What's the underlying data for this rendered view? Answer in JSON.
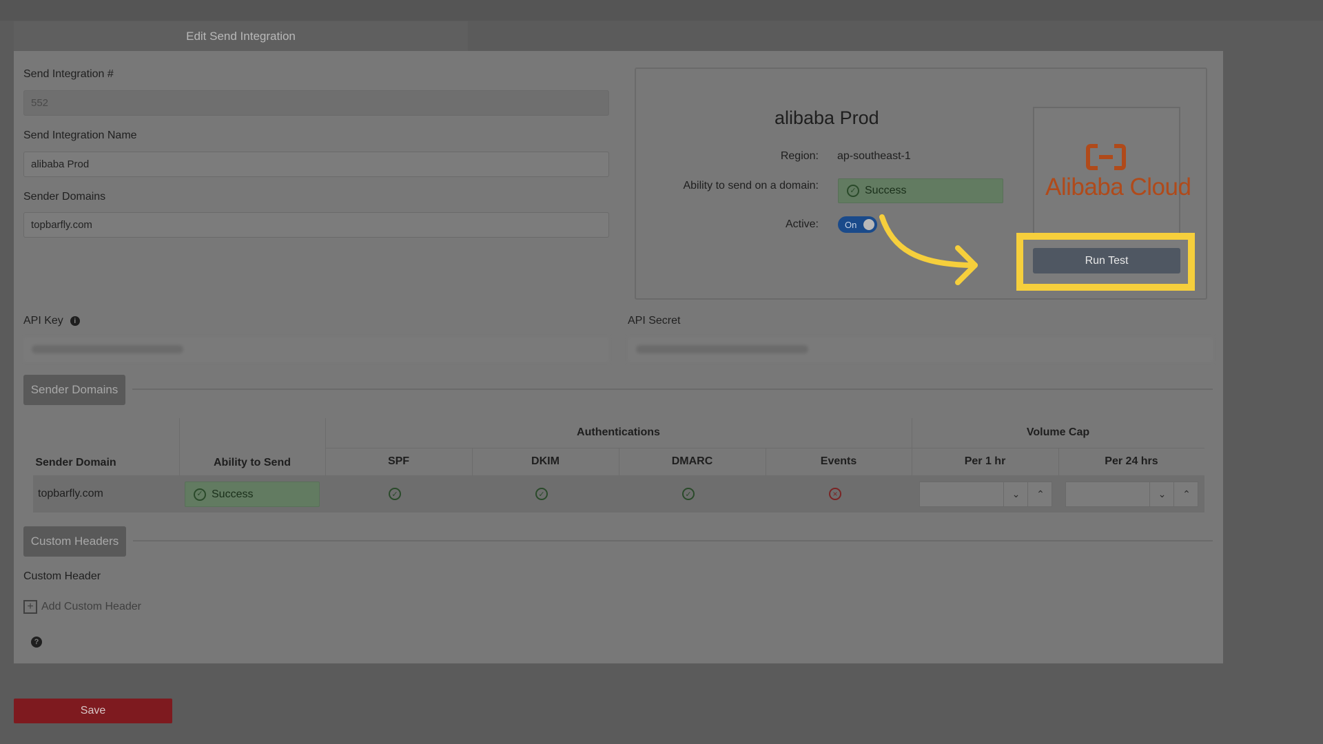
{
  "header": {
    "title": "Edit Send Integration"
  },
  "form": {
    "integration_number_label": "Send Integration #",
    "integration_number_value": "552",
    "integration_name_label": "Send Integration Name",
    "integration_name_value": "alibaba Prod",
    "sender_domains_label": "Sender Domains",
    "sender_domains_value": "topbarfly.com",
    "api_key_label": "API Key",
    "api_secret_label": "API Secret"
  },
  "card": {
    "title": "alibaba Prod",
    "region_label": "Region:",
    "region_value": "ap-southeast-1",
    "ability_label": "Ability to send on a domain:",
    "ability_value": "Success",
    "active_label": "Active:",
    "active_toggle": "On",
    "logo_text": "Alibaba Cloud",
    "run_test_label": "Run Test"
  },
  "sections": {
    "sender_domains": "Sender Domains",
    "custom_headers": "Custom Headers"
  },
  "table": {
    "group_authentications": "Authentications",
    "group_volume_cap": "Volume Cap",
    "columns": [
      "Sender Domain",
      "Ability to Send",
      "SPF",
      "DKIM",
      "DMARC",
      "Events",
      "Per 1 hr",
      "Per 24 hrs"
    ],
    "row": {
      "domain": "topbarfly.com",
      "ability": "Success",
      "spf": "pass",
      "dkim": "pass",
      "dmarc": "pass",
      "events": "fail"
    }
  },
  "custom_header": {
    "label": "Custom Header",
    "add_label": "Add Custom Header"
  },
  "footer": {
    "save_label": "Save"
  },
  "colors": {
    "highlight": "#f6cf3c",
    "save": "#7e1a1f",
    "toggle": "#1a4a8a"
  }
}
